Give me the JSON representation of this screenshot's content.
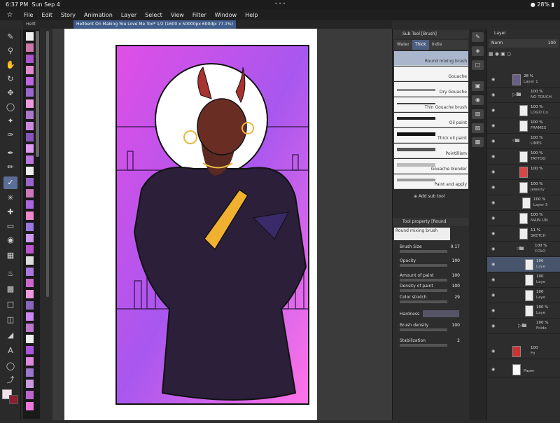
{
  "status": {
    "time": "6:37 PM",
    "date": "Sun Sep 4",
    "battery": "28%"
  },
  "menu": [
    "File",
    "Edit",
    "Story",
    "Animation",
    "Layer",
    "Select",
    "View",
    "Filter",
    "Window",
    "Help"
  ],
  "tabs": {
    "first": "Hellt",
    "active": "Hellbent On Making You Love Me Too* 1/2 (1600 x 50000px 600dpi 77.1%)"
  },
  "subtool": {
    "title": "Sub Tool [Brush]",
    "tabs": [
      "Water",
      "Thick",
      "Indie"
    ],
    "brushes": [
      "Round mixing brush",
      "Gouache",
      "Dry Gouache",
      "Thin Gouache brush",
      "Oil paint",
      "Thick oil paint",
      "Pointillism",
      "Gouache blender",
      "Paint and apply"
    ],
    "add_label": "Add sub tool"
  },
  "toolprop": {
    "title": "Tool property [Round",
    "brush_name": "Round mixing brush",
    "props": [
      {
        "label": "Brush Size",
        "value": "0.17"
      },
      {
        "label": "Opacity",
        "value": "100"
      },
      {
        "label": "Amount of paint",
        "value": "100"
      },
      {
        "label": "Density of paint",
        "value": "100"
      },
      {
        "label": "Color stretch",
        "value": "29"
      },
      {
        "label": "Hardness",
        "value": ""
      },
      {
        "label": "Brush density",
        "value": "100"
      },
      {
        "label": "Stabilization",
        "value": "2"
      }
    ]
  },
  "layers": {
    "title": "Layer",
    "blend": "Norm",
    "opacity": "100",
    "rows": [
      {
        "pct": "28 %",
        "name": "Layer 1"
      },
      {
        "pct": "100 %",
        "name": "NO TOUCH"
      },
      {
        "pct": "100 %",
        "name": "LOGO Co"
      },
      {
        "pct": "100 %",
        "name": "FRAMES"
      },
      {
        "pct": "100 %",
        "name": "LINES"
      },
      {
        "pct": "100 %",
        "name": "TATTOO"
      },
      {
        "pct": "100 %",
        "name": ""
      },
      {
        "pct": "100 %",
        "name": "jewelry"
      },
      {
        "pct": "100 %",
        "name": "Layer 5"
      },
      {
        "pct": "100 %",
        "name": "MAIN LIN"
      },
      {
        "pct": "11 %",
        "name": "SKETCH"
      },
      {
        "pct": "100 %",
        "name": "COLO"
      },
      {
        "pct": "100",
        "name": "Laye"
      },
      {
        "pct": "100",
        "name": "Laye"
      },
      {
        "pct": "100",
        "name": "Laye"
      },
      {
        "pct": "100 %",
        "name": "Laye"
      },
      {
        "pct": "100 %",
        "name": "Folde"
      },
      {
        "pct": "100",
        "name": "Fo"
      },
      {
        "pct": "",
        "name": "Paper"
      }
    ]
  }
}
